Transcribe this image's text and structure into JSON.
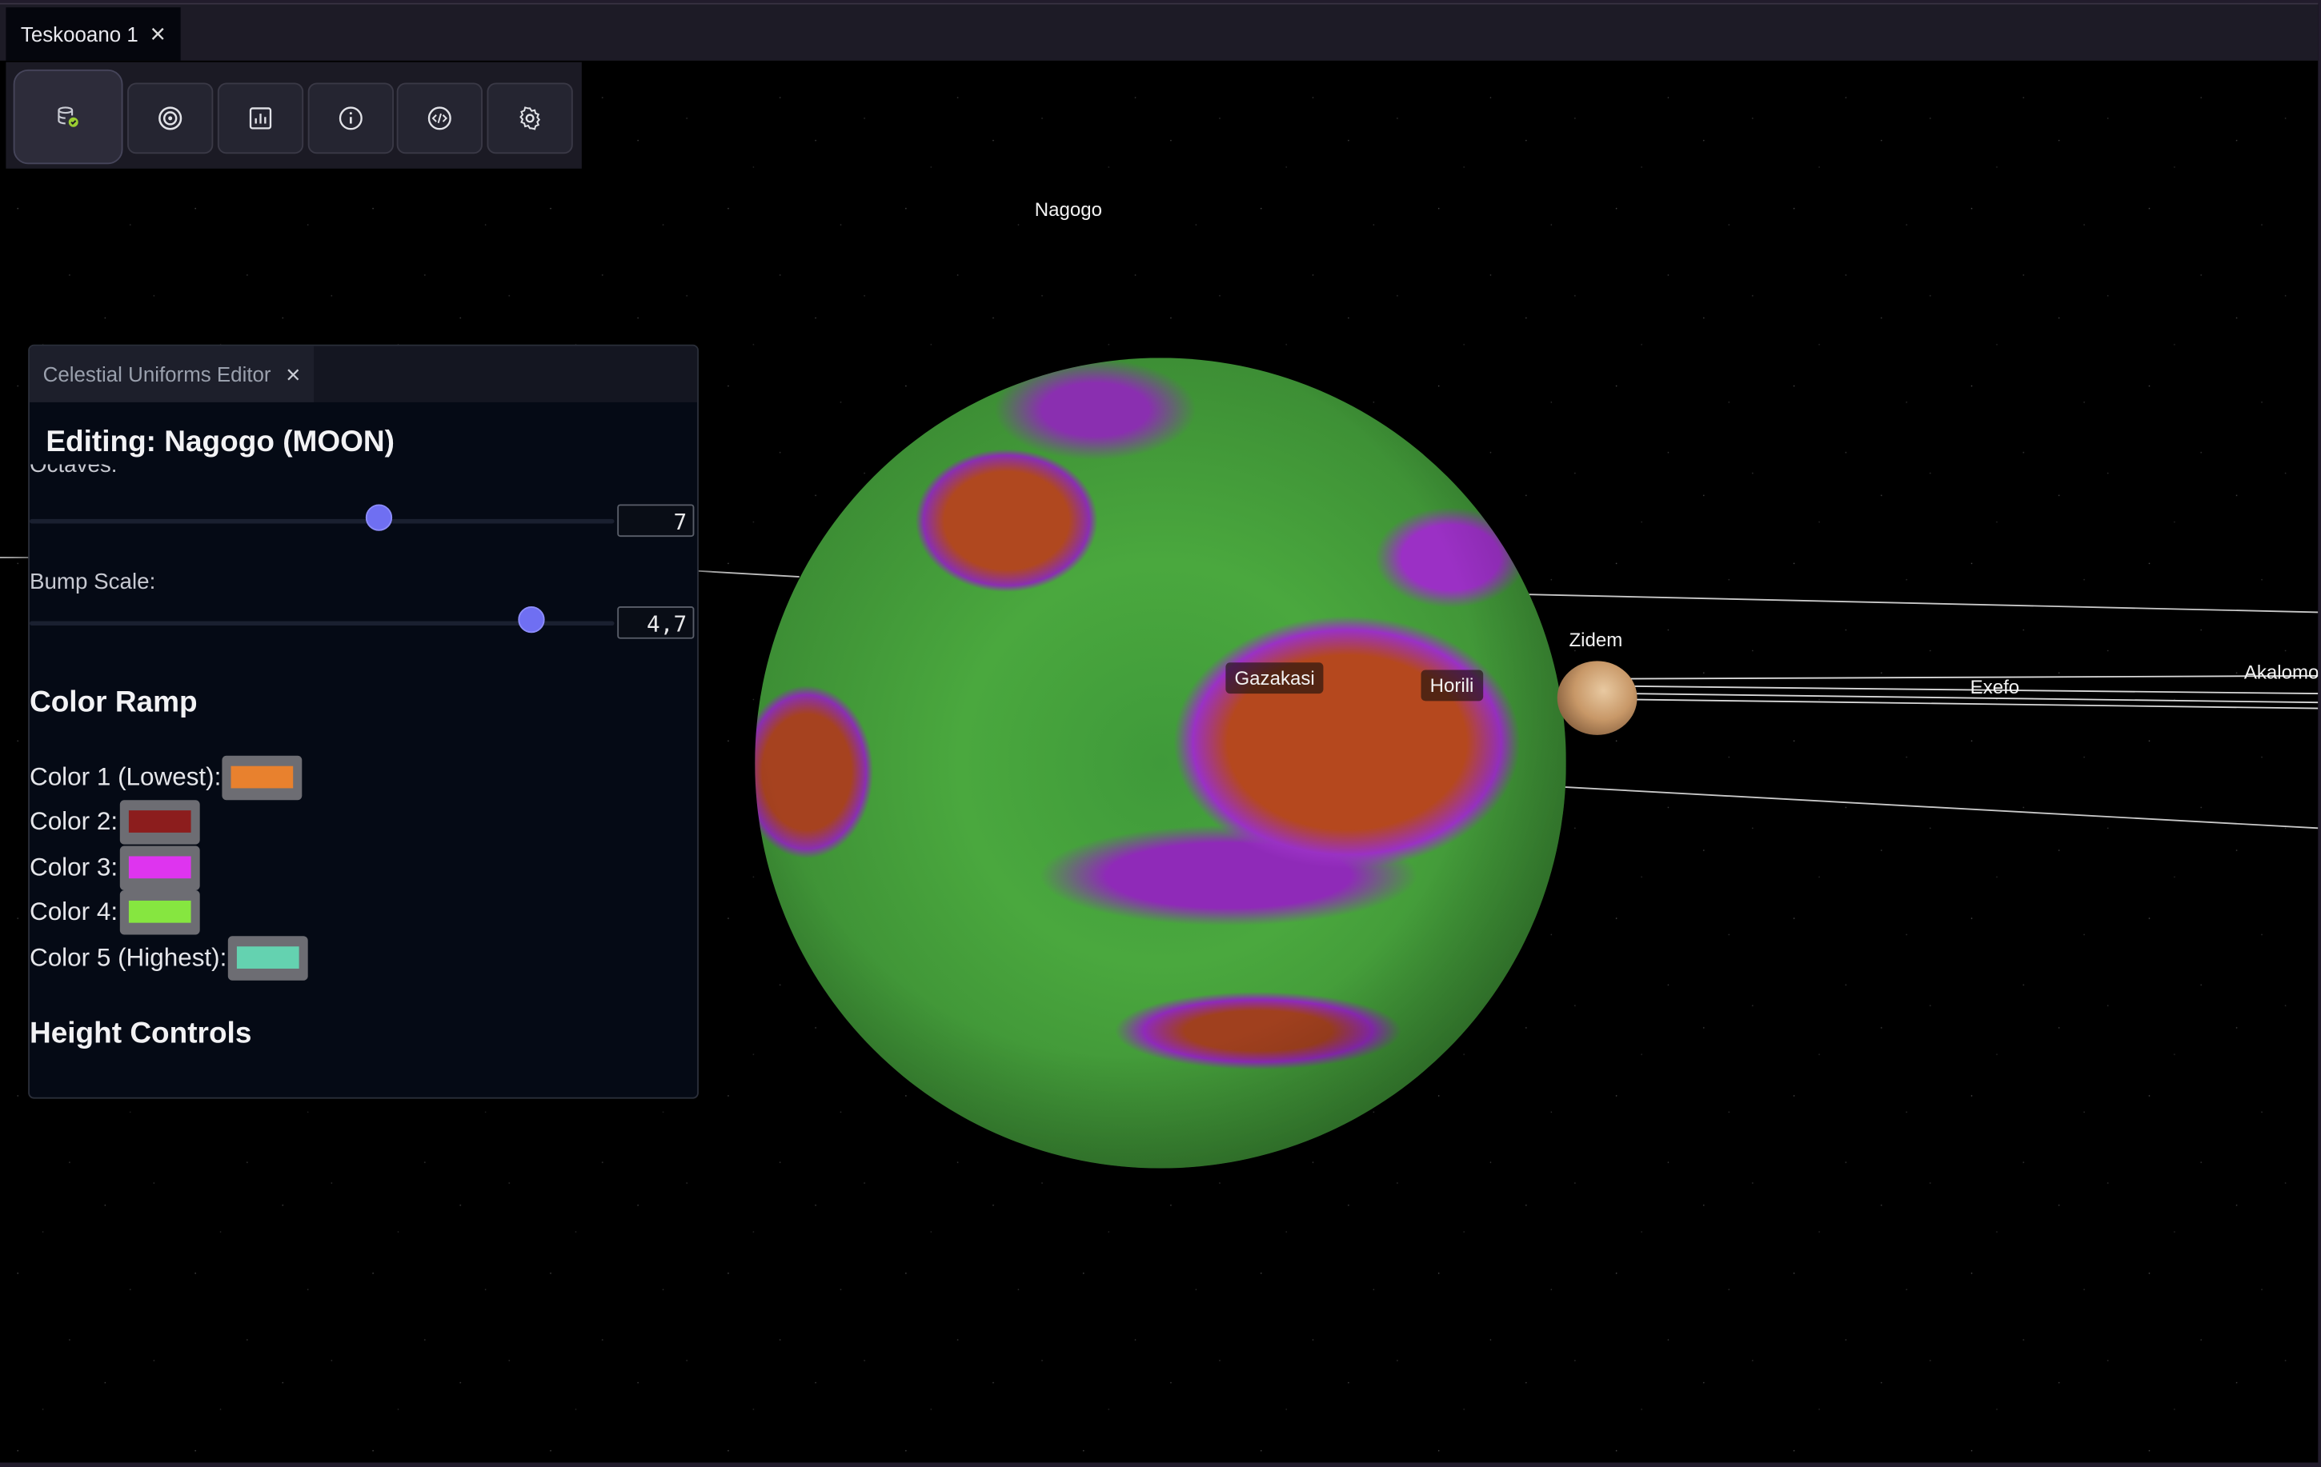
{
  "window": {
    "tab_title": "Teskooano 1",
    "tab_close": "×"
  },
  "toolbar": {
    "buttons": [
      {
        "icon": "focus-database-icon",
        "active": true
      },
      {
        "icon": "target-icon"
      },
      {
        "icon": "chart-icon"
      },
      {
        "icon": "info-icon"
      },
      {
        "icon": "code-icon"
      },
      {
        "icon": "gear-icon"
      }
    ]
  },
  "scene": {
    "labels": {
      "nagogo": "Nagogo",
      "gazakasi": "Gazakasi",
      "horili": "Horili",
      "zidem": "Zidem",
      "exefo": "Exefo",
      "akalomo": "Akalomo"
    }
  },
  "editor": {
    "tab_label": "Celestial Uniforms Editor",
    "tab_close": "×",
    "heading": "Editing: Nagogo (MOON)",
    "octaves_label": "Octaves:",
    "octaves_value": "7",
    "octaves_fraction": 0.6,
    "bump_label": "Bump Scale:",
    "bump_value": "4,7",
    "bump_fraction": 0.87,
    "color_ramp_heading": "Color Ramp",
    "colors": [
      {
        "label": "Color 1 (Lowest):",
        "hex": "#e8812e"
      },
      {
        "label": "Color 2:",
        "hex": "#8c1d1d"
      },
      {
        "label": "Color 3:",
        "hex": "#de34ef"
      },
      {
        "label": "Color 4:",
        "hex": "#86e640"
      },
      {
        "label": "Color 5 (Highest):",
        "hex": "#64d2b0"
      }
    ],
    "height_controls_heading": "Height Controls"
  }
}
